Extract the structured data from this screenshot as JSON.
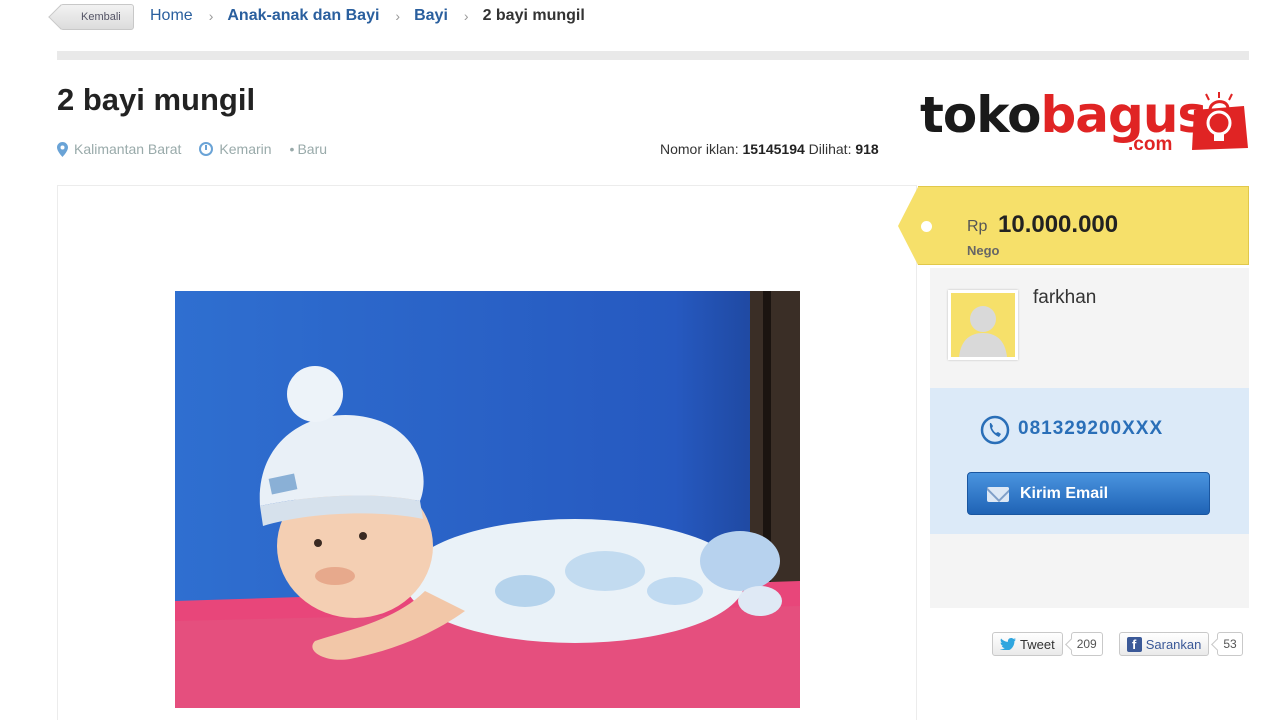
{
  "breadcrumb": {
    "back_label": "Kembali",
    "items": [
      "Home",
      "Anak-anak dan Bayi",
      "Bayi"
    ],
    "current": "2 bayi mungil"
  },
  "ad": {
    "title": "2 bayi mungil",
    "location": "Kalimantan Barat",
    "time": "Kemarin",
    "condition": "Baru",
    "ad_number_label": "Nomor iklan:",
    "ad_number": "15145194",
    "views_label": "Dilihat:",
    "views": "918"
  },
  "logo": {
    "part1": "toko",
    "part2": "bagus",
    "suffix": ".com"
  },
  "price": {
    "currency": "Rp",
    "amount": "10.000.000",
    "note": "Nego"
  },
  "seller": {
    "name": "farkhan",
    "phone": "081329200XXX",
    "email_button_label": "Kirim Email"
  },
  "social": {
    "tweet_label": "Tweet",
    "tweet_count": "209",
    "fb_label": "Sarankan",
    "fb_count": "53"
  },
  "colors": {
    "link": "#2a5f9e",
    "price_tag": "#f6e06a",
    "contact_bg": "#dceaf8",
    "button": "#1f63b5",
    "brand_red": "#e02424"
  }
}
